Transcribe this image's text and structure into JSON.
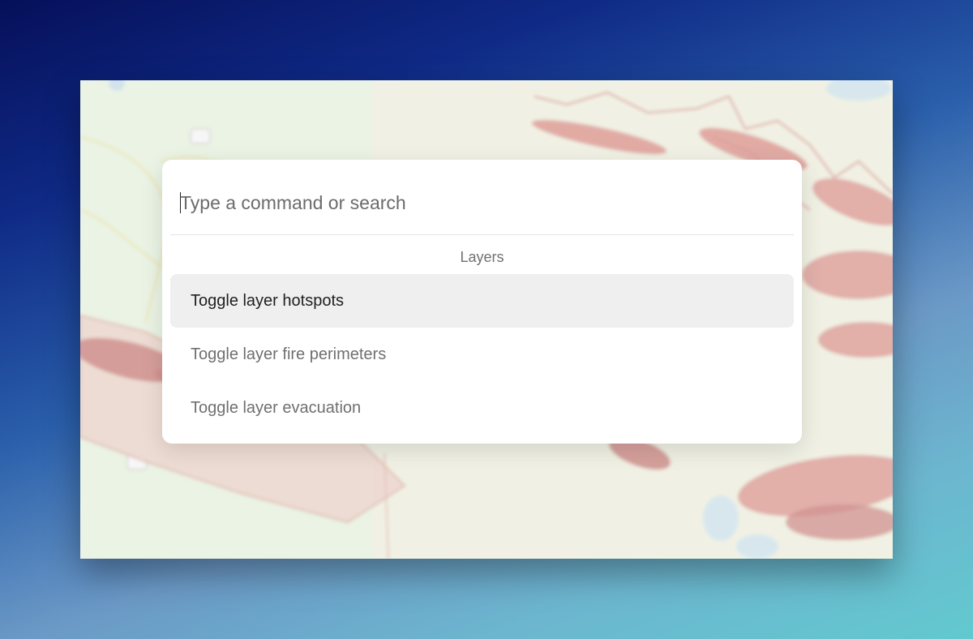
{
  "command_palette": {
    "search": {
      "placeholder": "Type a command or search",
      "value": ""
    },
    "group_heading": "Layers",
    "results": [
      {
        "label": "Toggle layer hotspots",
        "highlighted": true
      },
      {
        "label": "Toggle layer fire perimeters",
        "highlighted": false
      },
      {
        "label": "Toggle layer evacuation",
        "highlighted": false
      }
    ]
  },
  "colors": {
    "highlight_row": "#efefef",
    "map_land": "#e8f2e2",
    "fire_area": "#d89a92"
  }
}
